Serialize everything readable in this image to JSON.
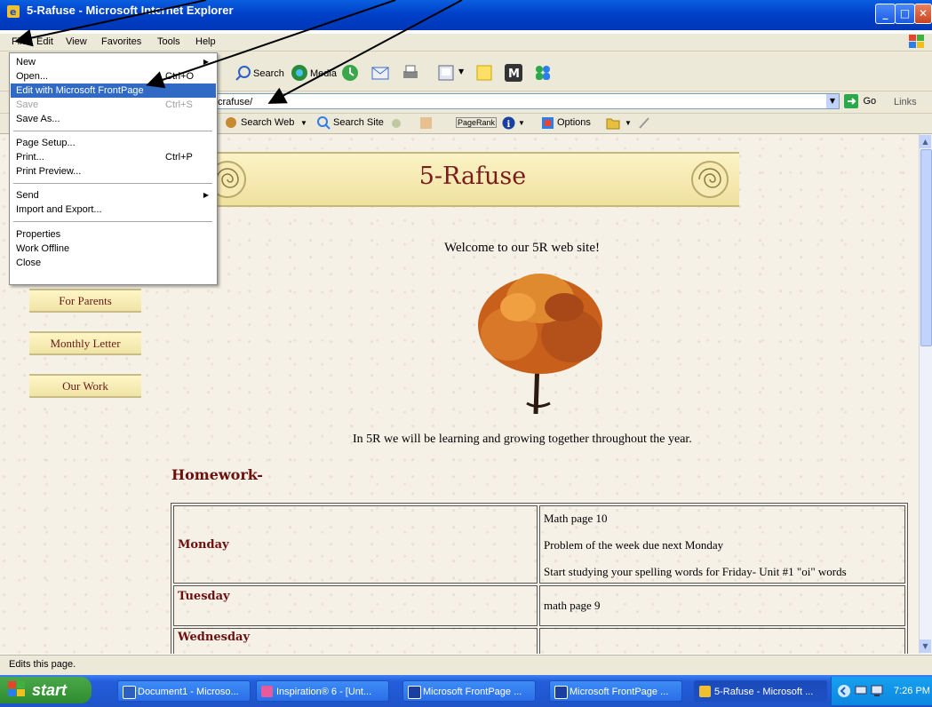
{
  "window": {
    "title": "5-Rafuse - Microsoft Internet Explorer",
    "buttons": {
      "minimize": "_",
      "maximize": "□",
      "close": "✕"
    }
  },
  "menubar": {
    "items": [
      "File",
      "Edit",
      "View",
      "Favorites",
      "Tools",
      "Help"
    ]
  },
  "toolbar": {
    "search": "Search",
    "media": "Media"
  },
  "addressbar": {
    "value": "crafuse/",
    "go": "Go",
    "links": "Links"
  },
  "searchbar": {
    "search_web": "Search Web",
    "search_site": "Search Site",
    "pagerank": "PageRank",
    "options": "Options"
  },
  "file_menu": {
    "items": [
      {
        "label": "New",
        "shortcut": "",
        "submenu": true
      },
      {
        "label": "Open...",
        "shortcut": "Ctrl+O"
      },
      {
        "label": "Edit with Microsoft FrontPage",
        "shortcut": "",
        "highlighted": true
      },
      {
        "label": "Save",
        "shortcut": "Ctrl+S",
        "disabled": true
      },
      {
        "label": "Save As...",
        "shortcut": ""
      },
      {
        "label": "Page Setup...",
        "shortcut": ""
      },
      {
        "label": "Print...",
        "shortcut": "Ctrl+P"
      },
      {
        "label": "Print Preview...",
        "shortcut": ""
      },
      {
        "label": "Send",
        "shortcut": "",
        "submenu": true
      },
      {
        "label": "Import and Export...",
        "shortcut": ""
      },
      {
        "label": "Properties",
        "shortcut": ""
      },
      {
        "label": "Work Offline",
        "shortcut": ""
      },
      {
        "label": "Close",
        "shortcut": ""
      }
    ]
  },
  "page": {
    "banner_title": "5-Rafuse",
    "nav": [
      "For Parents",
      "Monthly Letter",
      "Our Work"
    ],
    "welcome": "Welcome to our 5R web site!",
    "intro": "In 5R we will be learning and growing together throughout the year.",
    "homework_heading": "Homework-",
    "homework": [
      {
        "day": "Monday",
        "tasks": [
          "Math page 10",
          "Problem of the week due next Monday",
          "Start studying your spelling words for Friday- Unit #1 \"oi\" words"
        ]
      },
      {
        "day": "Tuesday",
        "tasks": [
          "math page 9"
        ]
      },
      {
        "day": "Wednesday",
        "tasks": [
          ""
        ]
      }
    ]
  },
  "statusbar": {
    "text": "Edits this page."
  },
  "taskbar": {
    "start": "start",
    "tasks": [
      "Document1 - Microso...",
      "Inspiration® 6 - [Unt...",
      "Microsoft FrontPage ...",
      "Microsoft FrontPage ...",
      "5-Rafuse - Microsoft ..."
    ],
    "clock": "7:26 PM"
  },
  "colors": {
    "title_blue": "#0040c8",
    "menu_highlight": "#316ac5",
    "heading_maroon": "#6b0f0f",
    "banner_gold": "#efe19e"
  }
}
